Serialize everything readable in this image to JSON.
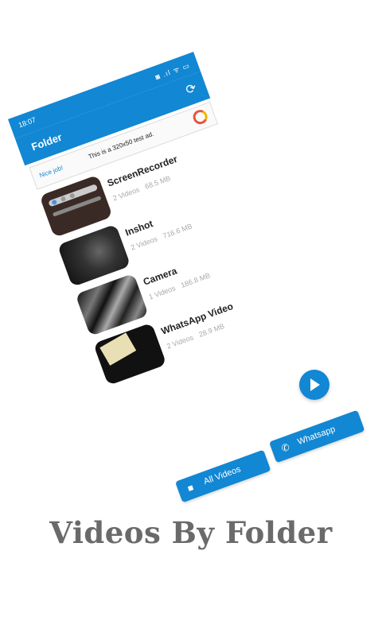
{
  "status_bar": {
    "time": "18:07",
    "icons": "◙ .ıl ᯤ ▭"
  },
  "app_bar": {
    "title": "Folder"
  },
  "ad": {
    "nice": "Nice job!",
    "text": "This is a 320x50 test ad."
  },
  "folders": [
    {
      "name": "ScreenRecorder",
      "count": "2 Videos",
      "size": "68.5 MB"
    },
    {
      "name": "Inshot",
      "count": "2 Videos",
      "size": "716.6 MB"
    },
    {
      "name": "Camera",
      "count": "1 Videos",
      "size": "186.8 MB"
    },
    {
      "name": "WhatsApp Video",
      "count": "2 Videos",
      "size": "28.9 MB"
    }
  ],
  "buttons": {
    "whatsapp": "Whatsapp",
    "all_videos": "All Videos"
  },
  "icons": {
    "refresh": "⟳",
    "whatsapp": "✆",
    "video": "■"
  },
  "headline": "Videos By Folder",
  "colors": {
    "primary": "#1287d3",
    "headline": "#6a6a6a"
  }
}
